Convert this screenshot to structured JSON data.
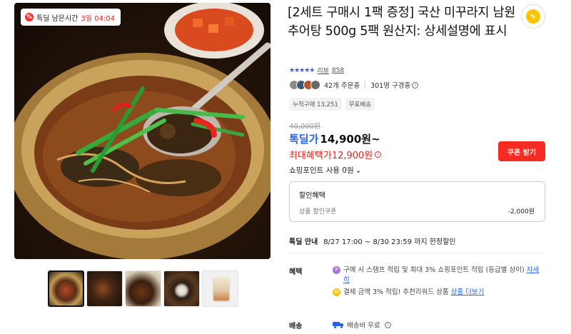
{
  "gallery": {
    "timer": {
      "label": "특딜 남은시간",
      "value": "3일 04:04"
    },
    "thumbnails": [
      {
        "name": "thumb-soup-bowl",
        "selected": true
      },
      {
        "name": "thumb-soup-spoon",
        "selected": false
      },
      {
        "name": "thumb-table-setting",
        "selected": false
      },
      {
        "name": "thumb-rice-set",
        "selected": false
      },
      {
        "name": "thumb-package",
        "selected": false
      }
    ]
  },
  "product": {
    "title": "[2세트 구매시 1팩 증정] 국산 미꾸라지 남원추어탕 500g 5팩 원산지: 상세설명에 표시",
    "brand_icon": "brand-logo-icon",
    "rating_stars": "★★★★★",
    "review_label": "리뷰",
    "review_count": "858",
    "orders": "42개 주문중",
    "viewers": "301명 구경중",
    "tags": [
      "누적구매 13,251",
      "무료배송"
    ]
  },
  "price": {
    "original": "40,000원",
    "deal_label": "톡딜가",
    "deal_price": "14,900원~",
    "max_benefit_label": "최대혜택가",
    "max_benefit_price": "12,900원",
    "coupon_button": "쿠폰 받기",
    "points_label": "쇼핑포인트 사용 0원",
    "benefit_box": {
      "title": "할인혜택",
      "item": "상품 할인쿠폰",
      "amount": "-2,000원"
    }
  },
  "deal_guide": {
    "label": "톡딜 안내",
    "period": "8/27 17:00 ~ 8/30 23:59 까지 한정할인"
  },
  "perks": {
    "label": "혜택",
    "point_text": "구매 시 스탬프 적립 및 최대 3% 쇼핑포인트 적립 (등급별 상이)",
    "point_link": "자세히",
    "reward_text": "결제 금액 3% 적립! 추천리워드 상품",
    "reward_link": "상품 더보기"
  },
  "shipping": {
    "label": "배송",
    "text": "배송비 무료"
  },
  "colors": {
    "accent_blue": "#2862e9",
    "accent_red": "#e8211a",
    "coupon_red": "#f42b22",
    "point_purple": "#a977d6",
    "reward_yellow": "#ffc400"
  }
}
